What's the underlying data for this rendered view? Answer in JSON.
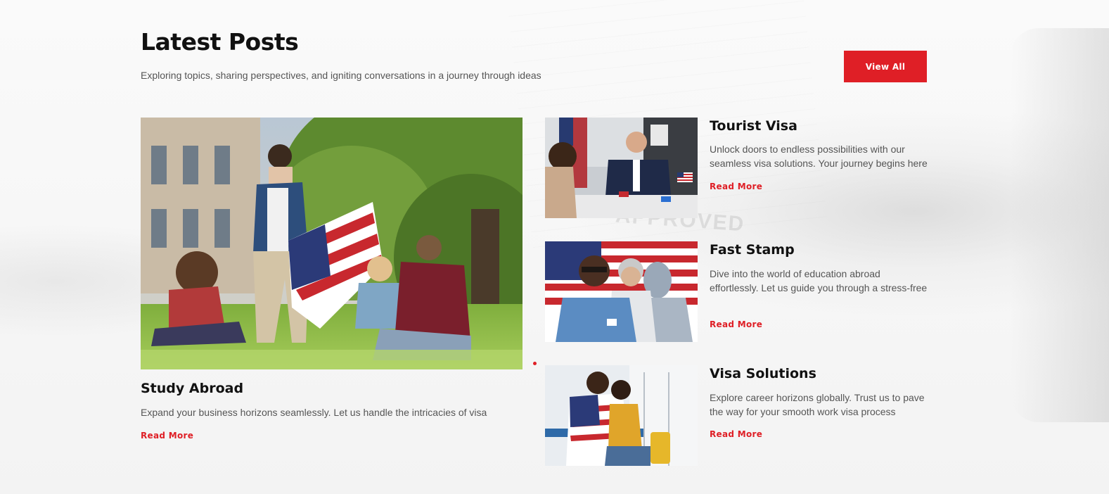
{
  "header": {
    "title": "Latest Posts",
    "subtitle": "Exploring topics, sharing perspectives, and igniting conversations in a journey through ideas",
    "view_all_label": "View All"
  },
  "featured": {
    "title": "Study Abroad",
    "description": "Expand your business horizons seamlessly. Let us handle the intricacies of visa",
    "read_more": "Read More",
    "image": "students-with-american-flag-photo"
  },
  "posts": [
    {
      "title": "Tourist Visa",
      "description": "Unlock doors to endless possibilities with our seamless visa solutions. Your journey begins here",
      "read_more": "Read More",
      "image": "visa-officer-interview-photo"
    },
    {
      "title": "Fast Stamp",
      "description": "Dive into the world of education abroad effortlessly. Let us guide you through a stress-free",
      "read_more": "Read More",
      "image": "people-in-front-of-flag-photo"
    },
    {
      "title": "Visa Solutions",
      "description": "Explore career horizons globally. Trust us to pave the way for your smooth work visa process",
      "read_more": "Read More",
      "image": "couple-with-flag-at-airport-photo"
    }
  ],
  "colors": {
    "accent": "#df1f26",
    "heading": "#111111",
    "body_text": "#555555"
  }
}
